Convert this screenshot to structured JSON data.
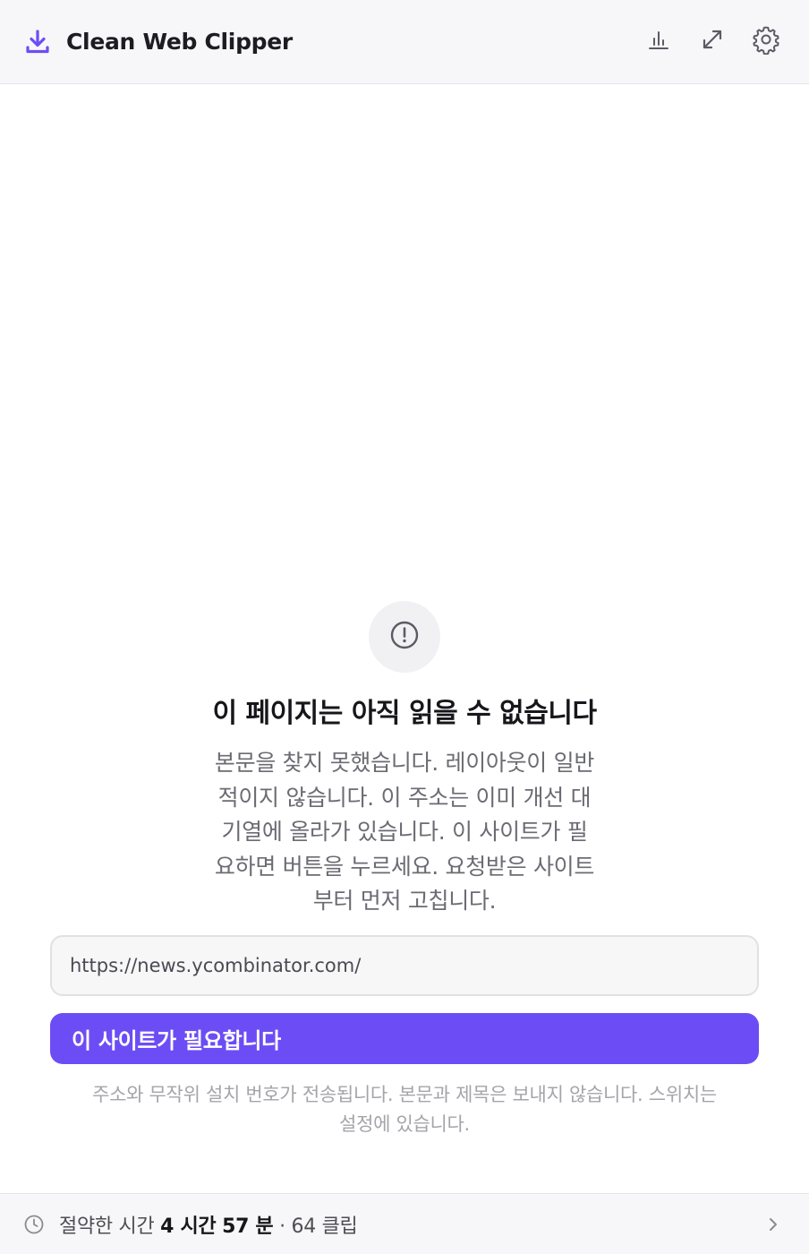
{
  "header": {
    "title": "Clean Web Clipper",
    "brand_icon": "download-icon",
    "accent_color": "#6c4df5",
    "actions": [
      {
        "icon": "bar-chart-icon"
      },
      {
        "icon": "expand-icon"
      },
      {
        "icon": "gear-icon"
      }
    ]
  },
  "empty_state": {
    "icon": "alert-circle-icon",
    "title": "이 페이지는 아직 읽을 수 없습니다",
    "description_lines": [
      "본문을 찾지 못했습니다. 레이아웃이 일반",
      "적이지 않습니다. 이 주소는 이미 개선 대",
      "기열에 올라가 있습니다. 이 사이트가 필",
      "요하면 버튼을 누르세요. 요청받은 사이트",
      "부터 먼저 고칩니다."
    ],
    "url_value": "https://news.ycombinator.com/",
    "button_label": "이 사이트가 필요합니다",
    "note_lines": [
      "주소와 무작위 설치 번호가 전송됩니다. 본문과 제목은 보내지 않습니다. 스위치는",
      "설정에 있습니다."
    ]
  },
  "footer": {
    "icon": "clock-icon",
    "prefix": "절약한 시간",
    "hours_value": "4 시간",
    "minutes_value": "57 분",
    "separator": "·",
    "clips": "64 클립",
    "chevron": "chevron-right-icon"
  }
}
